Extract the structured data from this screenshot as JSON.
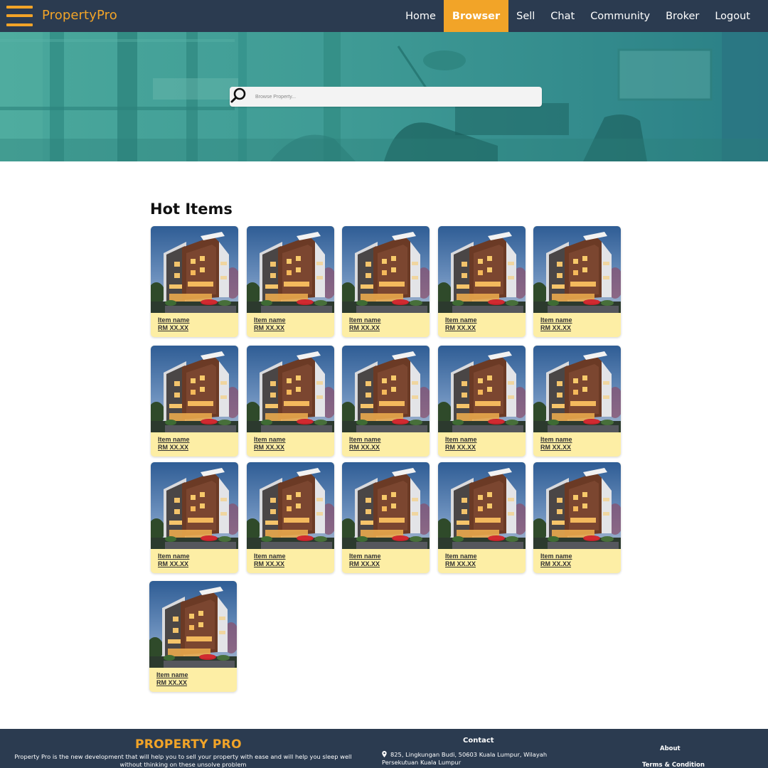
{
  "nav": {
    "brand": "PropertyPro",
    "links": [
      {
        "label": "Home",
        "active": false
      },
      {
        "label": "Browser",
        "active": true
      },
      {
        "label": "Sell",
        "active": false
      },
      {
        "label": "Chat",
        "active": false
      },
      {
        "label": "Community",
        "active": false
      },
      {
        "label": "Broker",
        "active": false
      },
      {
        "label": "Logout",
        "active": false
      }
    ]
  },
  "search": {
    "placeholder": "Browse Property...",
    "icon": "search-icon"
  },
  "hot_items": {
    "title": "Hot Items",
    "items": [
      {
        "name": "Item name",
        "price": "RM XX.XX"
      },
      {
        "name": "Item name",
        "price": "RM XX.XX"
      },
      {
        "name": "Item name",
        "price": "RM XX.XX"
      },
      {
        "name": "Item name",
        "price": "RM XX.XX"
      },
      {
        "name": "Item name",
        "price": "RM XX.XX"
      },
      {
        "name": "Item name",
        "price": "RM XX.XX"
      },
      {
        "name": "Item name",
        "price": "RM XX.XX"
      },
      {
        "name": "Item name",
        "price": "RM XX.XX"
      },
      {
        "name": "Item name",
        "price": "RM XX.XX"
      },
      {
        "name": "Item name",
        "price": "RM XX.XX"
      },
      {
        "name": "Item name",
        "price": "RM XX.XX"
      },
      {
        "name": "Item name",
        "price": "RM XX.XX"
      },
      {
        "name": "Item name",
        "price": "RM XX.XX"
      },
      {
        "name": "Item name",
        "price": "RM XX.XX"
      },
      {
        "name": "Item name",
        "price": "RM XX.XX"
      },
      {
        "name": "Item name",
        "price": "RM XX.XX"
      }
    ]
  },
  "footer": {
    "title": "PROPERTY PRO",
    "description": "Property Pro is the new development that will help you to sell your property with ease and will help you sleep well without thinking on these unsolve problem",
    "contact_title": "Contact",
    "address": "825, Lingkungan Budi, 50603 Kuala Lumpur, Wilayah Persekutuan Kuala Lumpur",
    "about": "About",
    "terms": "Terms & Condition"
  },
  "colors": {
    "navbar": "#2b3b50",
    "accent": "#f2a428",
    "card": "#fdeea5",
    "hero": "#3c9690"
  }
}
